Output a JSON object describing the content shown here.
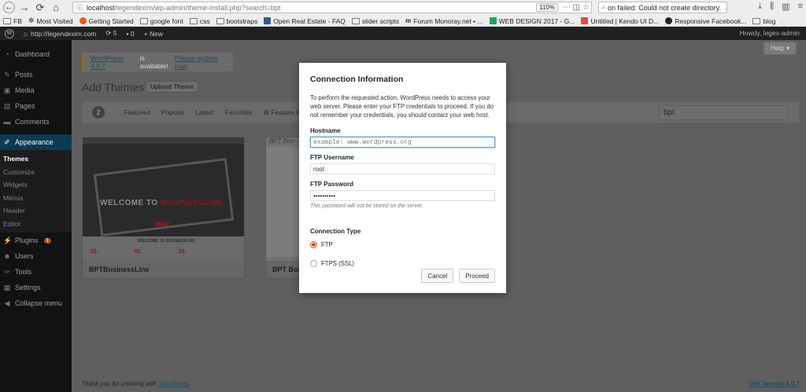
{
  "browser": {
    "url_host": "localhost",
    "url_path": "/legendexim/wp-admin/theme-install.php?search=bpt",
    "zoom": "110%",
    "search_text": "on failed: Could not create directory.",
    "bookmarks": [
      "FB",
      "Most Visited",
      "Getting Started",
      "google font",
      "css",
      "bootstraps",
      "Open Real Estate - FAQ",
      "slider scripts",
      "Forum Monoray.net • ...",
      "WEB DESIGN 2017 - G...",
      "Untitled | Kendo UI D...",
      "Responsive Facebook...",
      "blog"
    ]
  },
  "adminbar": {
    "site": "http://legendexim.com",
    "updates": "5",
    "comments": "0",
    "new": "New",
    "howdy": "Howdy, legex-admin"
  },
  "sidebar": {
    "items": [
      {
        "label": "Dashboard",
        "icon": "dashboard-icon"
      },
      {
        "label": "Posts",
        "icon": "pin-icon"
      },
      {
        "label": "Media",
        "icon": "media-icon"
      },
      {
        "label": "Pages",
        "icon": "page-icon"
      },
      {
        "label": "Comments",
        "icon": "comment-icon"
      },
      {
        "label": "Appearance",
        "icon": "brush-icon"
      },
      {
        "label": "Plugins",
        "icon": "plugin-icon",
        "badge": "1"
      },
      {
        "label": "Users",
        "icon": "user-icon"
      },
      {
        "label": "Tools",
        "icon": "wrench-icon"
      },
      {
        "label": "Settings",
        "icon": "settings-icon"
      },
      {
        "label": "Collapse menu",
        "icon": "collapse-icon"
      }
    ],
    "appearance_sub": [
      "Themes",
      "Customize",
      "Widgets",
      "Menus",
      "Header",
      "Editor"
    ]
  },
  "main": {
    "help": "Help ▾",
    "notice_link1": "WordPress 4.9.7",
    "notice_text": " is available! ",
    "notice_link2": "Please update now",
    "title": "Add Themes",
    "upload": "Upload Theme",
    "count": "2",
    "filters": [
      "Featured",
      "Popular",
      "Latest",
      "Favorites",
      "Feature Filter"
    ],
    "search_value": "bpt",
    "themes": [
      {
        "name": "BPTBusinessLine",
        "hero_a": "WELCOME TO ",
        "hero_b": "BUSINESSLINE",
        "lower_title": "WELCOME TO BUSINESSLINE",
        "nums": [
          "01.",
          "02.",
          "03."
        ]
      },
      {
        "name": "BPT Boo",
        "corner": "BPT Boo"
      }
    ],
    "footer_text": "Thank you for creating with ",
    "footer_link": "WordPress",
    "footer_version": "Get Version 4.9.7"
  },
  "modal": {
    "title": "Connection Information",
    "description": "To perform the requested action, WordPress needs to access your web server. Please enter your FTP credentials to proceed. If you do not remember your credentials, you should contact your web host.",
    "hostname_label": "Hostname",
    "hostname_placeholder": "example: www.wordpress.org",
    "username_label": "FTP Username",
    "username_value": "root",
    "password_label": "FTP Password",
    "password_value": "••••••••••",
    "password_hint": "This password will not be stored on the server.",
    "conn_type_label": "Connection Type",
    "options": [
      "FTP",
      "FTPS (SSL)"
    ],
    "selected": "FTP",
    "cancel": "Cancel",
    "proceed": "Proceed"
  }
}
